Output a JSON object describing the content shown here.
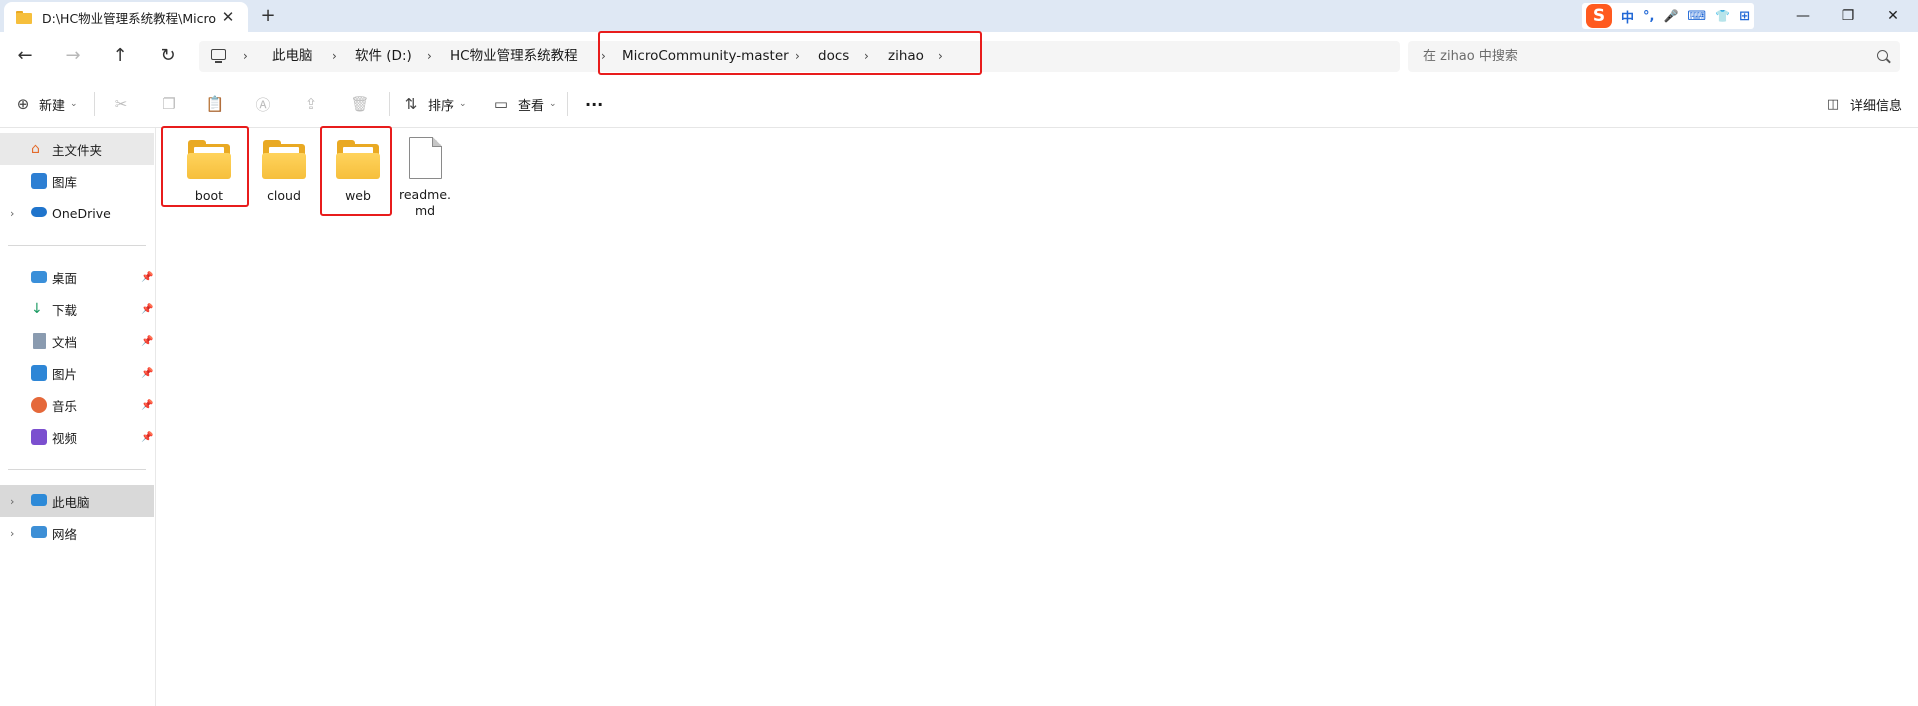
{
  "window": {
    "tab_title": "D:\\HC物业管理系统教程\\Micro",
    "tab_close": "✕",
    "tab_add": "+",
    "controls": {
      "minimize": "—",
      "maximize": "❐",
      "close": "✕"
    }
  },
  "ime": {
    "logo": "S",
    "mode": "中",
    "punct": "°,",
    "mic": "🎤",
    "keyboard": "⌨",
    "skin": "👕",
    "grid": "⊞"
  },
  "address": {
    "crumbs": [
      "此电脑",
      "软件 (D:)",
      "HC物业管理系统教程",
      "MicroCommunity-master",
      "docs",
      "zihao"
    ],
    "separator": "›",
    "search_placeholder": "在 zihao 中搜索"
  },
  "toolbar": {
    "new_label": "新建",
    "sort_label": "排序",
    "view_label": "查看",
    "more_label": "···",
    "details_label": "详细信息"
  },
  "sidebar": {
    "items": [
      {
        "label": "主文件夹"
      },
      {
        "label": "图库"
      },
      {
        "label": "OneDrive"
      },
      {
        "label": "桌面"
      },
      {
        "label": "下载"
      },
      {
        "label": "文档"
      },
      {
        "label": "图片"
      },
      {
        "label": "音乐"
      },
      {
        "label": "视频"
      },
      {
        "label": "此电脑"
      },
      {
        "label": "网络"
      }
    ]
  },
  "files": [
    {
      "name": "boot",
      "type": "folder"
    },
    {
      "name": "cloud",
      "type": "folder"
    },
    {
      "name": "web",
      "type": "folder"
    },
    {
      "name": "readme.md",
      "type": "file"
    }
  ],
  "colors": {
    "highlight": "#e81c1c",
    "folder": "#ffd35c",
    "titlebar": "#dfe8f4"
  }
}
